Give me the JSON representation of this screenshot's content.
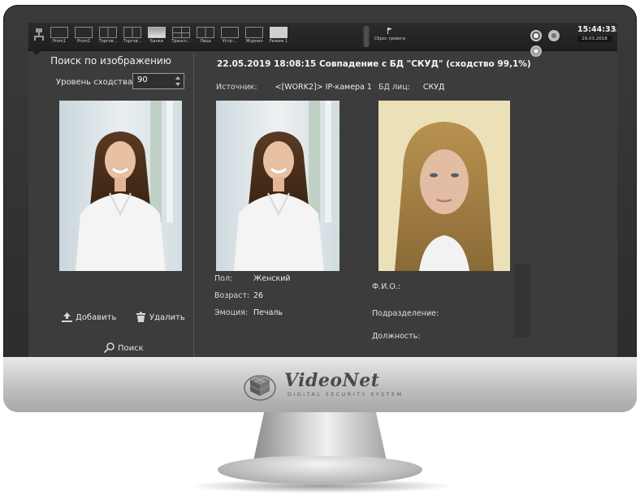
{
  "toolbar": {
    "items": [
      {
        "label": "Prom1"
      },
      {
        "label": "Prom2"
      },
      {
        "label": "Торгов..."
      },
      {
        "label": "Торгов..."
      },
      {
        "label": "Банки"
      },
      {
        "label": "Трансп..."
      },
      {
        "label": "Лица"
      },
      {
        "label": "Устр-..."
      },
      {
        "label": "Журнал"
      },
      {
        "label": "Режим 1"
      }
    ],
    "alarm_reset_label": "Сброс тревоги",
    "time": "15:44:33",
    "date": "29.03.2018"
  },
  "left_panel": {
    "title": "Поиск по изображению",
    "similarity_label": "Уровень сходства",
    "similarity_value": "90",
    "add_label": "Добавить",
    "delete_label": "Удалить",
    "search_label": "Поиск"
  },
  "match": {
    "title": "22.05.2019 18:08:15 Совпадение с БД \"СКУД\" (сходство 99,1%)",
    "source_label": "Источник:",
    "source_value": "<[WORK2]> IP-камера 1",
    "db_label": "БД лиц:",
    "db_value": "СКУД",
    "attributes": [
      {
        "label": "Пол:",
        "value": "Женский"
      },
      {
        "label": "Возраст:",
        "value": "26"
      },
      {
        "label": "Эмоция:",
        "value": "Печаль"
      }
    ],
    "person_fields": [
      {
        "label": "Ф.И.О.:"
      },
      {
        "label": "Подразделение:"
      },
      {
        "label": "Должность:"
      }
    ]
  },
  "brand": {
    "name": "VideoNet",
    "tagline": "DIGITAL SECURITY SYSTEM"
  },
  "icons": {
    "app": "camera-tree-icon",
    "layout": "screen-layout-icon",
    "alarm": "flag-icon",
    "add": "upload-icon",
    "delete": "trash-icon",
    "search": "magnifier-icon"
  },
  "colors": {
    "screen_bg": "#3c3c3c",
    "toolbar_bg": "#1f1f1f",
    "text": "#e6e6e6"
  }
}
